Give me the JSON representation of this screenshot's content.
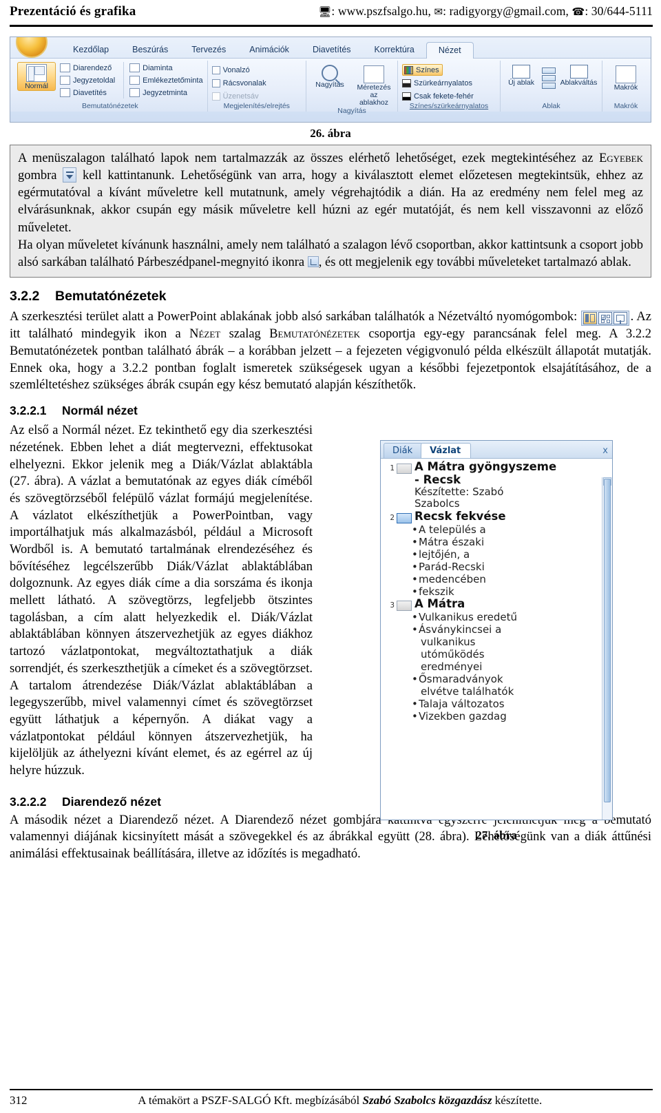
{
  "header": {
    "left_title": "Prezentáció és grafika",
    "web_icon": "monitor-icon",
    "web": "www.pszfsalgo.hu,",
    "mail_icon": "envelope-icon",
    "mail": "radigyorgy@gmail.com,",
    "phone_icon": "telephone-icon",
    "phone": "30/644-5111"
  },
  "ribbon": {
    "orb": "office-orb",
    "tabs": [
      {
        "label": "Kezdőlap",
        "active": false
      },
      {
        "label": "Beszúrás",
        "active": false
      },
      {
        "label": "Tervezés",
        "active": false
      },
      {
        "label": "Animációk",
        "active": false
      },
      {
        "label": "Diavetítés",
        "active": false
      },
      {
        "label": "Korrektúra",
        "active": false
      },
      {
        "label": "Nézet",
        "active": true
      }
    ],
    "groups": [
      {
        "label": "Bemutatónézetek",
        "big_button": "Normál",
        "items": [
          "Diarendező",
          "Jegyzetoldal",
          "Diavetítés"
        ],
        "items2": [
          "Diaminta",
          "Emlékeztetőminta",
          "Jegyzetminta"
        ]
      },
      {
        "label": "Megjelenítés/elrejtés",
        "checkboxes": [
          {
            "label": "Vonalzó",
            "disabled": false
          },
          {
            "label": "Rácsvonalak",
            "disabled": false
          },
          {
            "label": "Üzenetsáv",
            "disabled": true
          }
        ]
      },
      {
        "label": "Nagyítás",
        "buttons": [
          "Nagyítás",
          "Méretezés az ablakhoz"
        ]
      },
      {
        "label": "Színes/szürkeárnyalatos",
        "options": [
          {
            "label": "Színes",
            "selected": true
          },
          {
            "label": "Szürkeárnyalatos",
            "selected": false
          },
          {
            "label": "Csak fekete-fehér",
            "selected": false
          }
        ]
      },
      {
        "label": "Ablak",
        "buttons": [
          "Új ablak",
          "Ablakváltás"
        ]
      },
      {
        "label": "Makrók",
        "buttons": [
          "Makrók"
        ]
      }
    ]
  },
  "figure26": {
    "caption": "26. ábra"
  },
  "note_box": {
    "p1_a": "A menüszalagon található lapok nem tartalmazzák az összes elérhető lehetőséget, ezek megtekintéséhez az ",
    "p1_sc": "Egyebek",
    "p1_b": " gombra ",
    "p1_c": " kell kattintanunk. Lehetőségünk van arra, hogy a kiválasztott elemet előzetesen megtekintsük, ehhez az egérmutatóval a kívánt műveletre kell mutatnunk, amely végrehajtódik a dián. Ha az eredmény nem felel meg az elvárásunknak, akkor csupán egy másik műveletre kell húzni az egér mutatóját, és nem kell visszavonni az előző műveletet.",
    "p2_a": "Ha olyan műveletet kívánunk használni, amely nem található a szalagon lévő csoportban, akkor kattintsunk a csoport jobb alsó sarkában található Párbeszédpanel-megnyitó ikonra ",
    "p2_b": ", és ott megjelenik egy további műveleteket tartalmazó ablak."
  },
  "section_322": {
    "number": "3.2.2",
    "title": "Bemutatónézetek",
    "para_a": "A szerkesztési terület alatt a PowerPoint ablakának jobb alsó sarkában találhatók a Nézetváltó nyomógombok: ",
    "para_b": ". Az itt található mindegyik ikon a ",
    "para_sc1": "Nézet",
    "para_c": " szalag ",
    "para_sc2": "Bemutatónézetek",
    "para_d": " csoportja egy-egy parancsának felel meg. A 3.2.2 Bemutatónézetek pontban található ábrák – a korábban jelzett – a fejezeten végigvonuló példa elkészült állapotát mutatják. Ennek oka, hogy a 3.2.2 pontban foglalt ismeretek szükségesek ugyan a későbbi fejezetpontok elsajátításához, de a szemléltetéshez szükséges ábrák csupán egy kész bemutató alapján készíthetők."
  },
  "section_3221": {
    "number": "3.2.2.1",
    "title": "Normál nézet",
    "body": "Az első a Normál nézet. Ez tekinthető egy dia szerkesztési nézetének. Ebben lehet a diát megtervezni, effektusokat elhelyezni. Ekkor jelenik meg a Diák/Vázlat ablaktábla (27. ábra). A vázlat a bemutatónak az egyes diák címéből és szövegtörzséből felépülő vázlat formájú megjelenítése. A vázlatot elkészíthetjük a PowerPointban, vagy importálhatjuk más alkalmazásból, például a Microsoft Wordből is. A bemutató tartalmának elrendezéséhez és bővítéséhez legcélszerűbb Diák/Vázlat ablaktáblában dolgoznunk. Az egyes diák címe a dia sorszáma és ikonja mellett látható. A szövegtörzs, legfeljebb ötszintes tagolásban, a cím alatt helyezkedik el. Diák/Vázlat ablaktáblában könnyen átszervezhetjük az egyes diákhoz tartozó vázlatpontokat, megváltoztathatjuk a diák sorrendjét, és szerkeszthetjük a címeket és a szövegtörzset. A tartalom átrendezése Diák/Vázlat ablaktáblában a legegyszerűbb, mivel valamennyi címet és szövegtörzset együtt láthatjuk a képernyőn. A diákat vagy a vázlatpontokat például könnyen átszervezhetjük, ha kijelöljük az áthelyezni kívánt elemet, és az egérrel az új helyre húzzuk."
  },
  "outline_pane": {
    "tabs": [
      {
        "label": "Diák",
        "active": false
      },
      {
        "label": "Vázlat",
        "active": true
      }
    ],
    "close_label": "x",
    "slides": [
      {
        "number": "1",
        "icon_selected": false,
        "title_lines": [
          "A Mátra gyöngyszeme",
          "- Recsk"
        ],
        "subtitle_lines": [
          "Készítette:  Szabó",
          "Szabolcs"
        ],
        "bullets": []
      },
      {
        "number": "2",
        "icon_selected": true,
        "title_lines": [
          "Recsk fekvése"
        ],
        "subtitle_lines": [],
        "bullets": [
          {
            "lines": [
              "A település a"
            ]
          },
          {
            "lines": [
              "Mátra északi"
            ]
          },
          {
            "lines": [
              "lejtőjén, a"
            ]
          },
          {
            "lines": [
              "Parád-Recski"
            ]
          },
          {
            "lines": [
              "medencében"
            ]
          },
          {
            "lines": [
              "fekszik"
            ]
          }
        ]
      },
      {
        "number": "3",
        "icon_selected": false,
        "title_lines": [
          "A Mátra"
        ],
        "subtitle_lines": [],
        "bullets": [
          {
            "lines": [
              "Vulkanikus eredetű"
            ]
          },
          {
            "lines": [
              "Ásványkincsei a",
              "vulkanikus",
              "utóműködés",
              "eredményei"
            ]
          },
          {
            "lines": [
              "Ősmaradványok",
              "elvétve találhatók"
            ]
          },
          {
            "lines": [
              "Talaja változatos"
            ]
          },
          {
            "lines": [
              "Vizekben gazdag"
            ]
          }
        ]
      }
    ]
  },
  "figure27": {
    "caption": "27. ábra"
  },
  "section_3222": {
    "number": "3.2.2.2",
    "title": "Diarendező nézet",
    "body": "A második nézet a Diarendező nézet. A Diarendező nézet gombjára kattintva egyszerre jeleníthetjük meg a bemutató valamennyi diájának kicsinyített mását a szövegekkel és az ábrákkal együtt (28. ábra). Lehetőségünk van a diák áttűnési animálási effektusainak beállítására, illetve az időzítés is megadható."
  },
  "footer": {
    "page_number": "312",
    "text_a": "A témakört a PSZF-SALGÓ Kft. megbízásából ",
    "text_b": "Szabó Szabolcs közgazdász",
    "text_c": " készítette."
  }
}
